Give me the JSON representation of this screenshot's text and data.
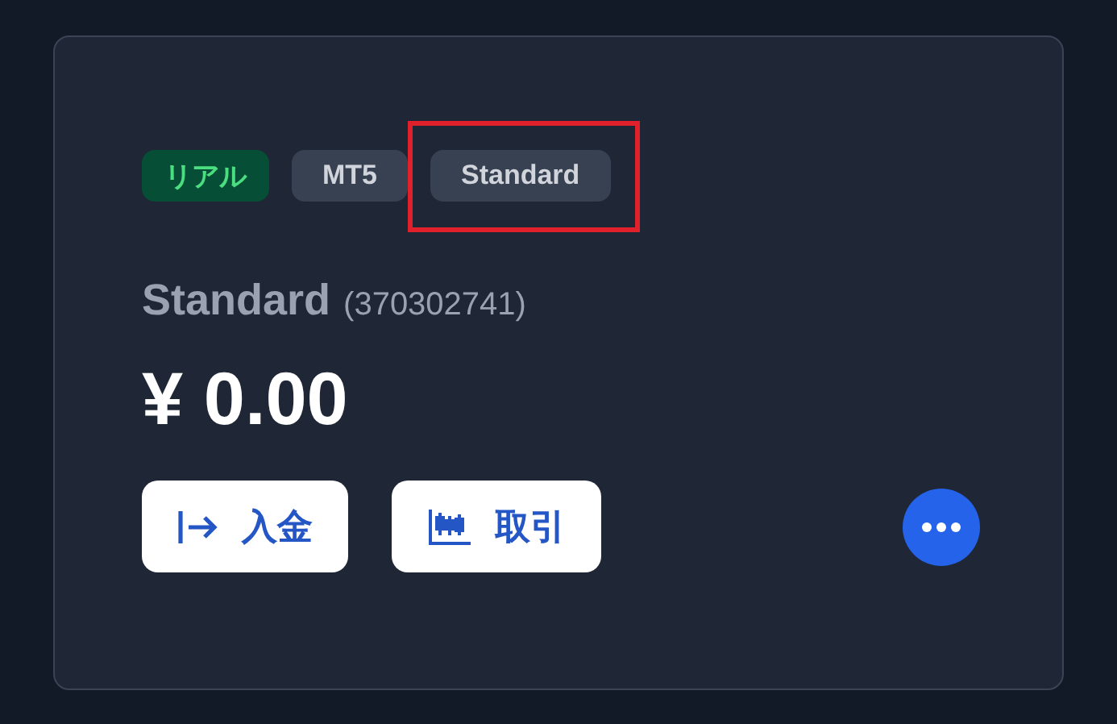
{
  "card": {
    "tags": [
      {
        "label": "リアル",
        "kind": "account",
        "highlighted": false
      },
      {
        "label": "MT5",
        "kind": "platform",
        "highlighted": false
      },
      {
        "label": "Standard",
        "kind": "platform",
        "highlighted": true
      }
    ],
    "account_name": "Standard",
    "account_number": "(370302741)",
    "balance": "¥ 0.00",
    "buttons": [
      {
        "label": "入金",
        "kind": "deposit"
      },
      {
        "label": "取引",
        "kind": "trade"
      }
    ]
  }
}
